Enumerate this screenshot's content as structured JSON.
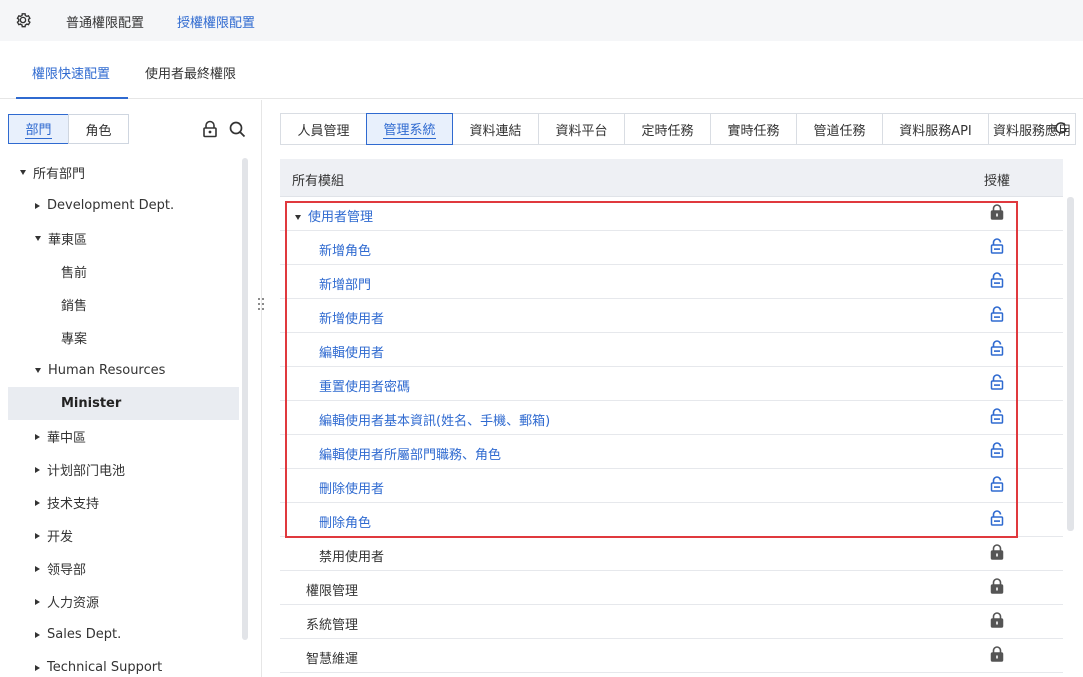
{
  "topbar": {
    "tabs": [
      "普通權限配置",
      "授權權限配置"
    ],
    "active_tab": 1
  },
  "subtabs": {
    "items": [
      "權限快速配置",
      "使用者最終權限"
    ],
    "active": 0
  },
  "left": {
    "segments": [
      "部門",
      "角色"
    ],
    "active_segment": 0,
    "tree": [
      {
        "label": "所有部門",
        "level": 0,
        "caret": "down"
      },
      {
        "label": "Development Dept.",
        "level": 1,
        "caret": "right"
      },
      {
        "label": "華東區",
        "level": 1,
        "caret": "down"
      },
      {
        "label": "售前",
        "level": 2,
        "caret": "none"
      },
      {
        "label": "銷售",
        "level": 2,
        "caret": "none"
      },
      {
        "label": "專案",
        "level": 2,
        "caret": "none"
      },
      {
        "label": "Human Resources",
        "level": 1,
        "caret": "down"
      },
      {
        "label": "Minister",
        "level": 2,
        "caret": "none",
        "selected": true
      },
      {
        "label": "華中區",
        "level": 1,
        "caret": "right"
      },
      {
        "label": "计划部门电池",
        "level": 1,
        "caret": "right"
      },
      {
        "label": "技术支持",
        "level": 1,
        "caret": "right"
      },
      {
        "label": "开发",
        "level": 1,
        "caret": "right"
      },
      {
        "label": "领导部",
        "level": 1,
        "caret": "right"
      },
      {
        "label": "人力资源",
        "level": 1,
        "caret": "right"
      },
      {
        "label": "Sales Dept.",
        "level": 1,
        "caret": "right"
      },
      {
        "label": "Technical Support",
        "level": 1,
        "caret": "right"
      }
    ]
  },
  "modules": {
    "tabs": [
      "人員管理",
      "管理系統",
      "資料連結",
      "資料平台",
      "定時任務",
      "實時任務",
      "管道任務",
      "資料服務API",
      "資料服務應用"
    ],
    "active": 1
  },
  "table": {
    "header_module": "所有模組",
    "header_auth": "授權",
    "rows": [
      {
        "label": "使用者管理",
        "indent": 1,
        "caret": "down",
        "color": "blue",
        "lock": "locked"
      },
      {
        "label": "新增角色",
        "indent": 2,
        "caret": "none",
        "color": "blue",
        "lock": "unlocked"
      },
      {
        "label": "新增部門",
        "indent": 2,
        "caret": "none",
        "color": "blue",
        "lock": "unlocked"
      },
      {
        "label": "新增使用者",
        "indent": 2,
        "caret": "none",
        "color": "blue",
        "lock": "unlocked"
      },
      {
        "label": "編輯使用者",
        "indent": 2,
        "caret": "none",
        "color": "blue",
        "lock": "unlocked"
      },
      {
        "label": "重置使用者密碼",
        "indent": 2,
        "caret": "none",
        "color": "blue",
        "lock": "unlocked"
      },
      {
        "label": "編輯使用者基本資訊(姓名、手機、郵箱)",
        "indent": 2,
        "caret": "none",
        "color": "blue",
        "lock": "unlocked"
      },
      {
        "label": "編輯使用者所屬部門職務、角色",
        "indent": 2,
        "caret": "none",
        "color": "blue",
        "lock": "unlocked"
      },
      {
        "label": "刪除使用者",
        "indent": 2,
        "caret": "none",
        "color": "blue",
        "lock": "unlocked"
      },
      {
        "label": "刪除角色",
        "indent": 2,
        "caret": "none",
        "color": "blue",
        "lock": "unlocked"
      },
      {
        "label": "禁用使用者",
        "indent": 2,
        "caret": "none",
        "color": "dark",
        "lock": "locked"
      },
      {
        "label": "權限管理",
        "indent": 1,
        "caret": "none",
        "color": "dark",
        "lock": "locked"
      },
      {
        "label": "系統管理",
        "indent": 1,
        "caret": "none",
        "color": "dark",
        "lock": "locked"
      },
      {
        "label": "智慧維運",
        "indent": 1,
        "caret": "none",
        "color": "dark",
        "lock": "locked"
      }
    ]
  },
  "colors": {
    "accent": "#2f6ad0",
    "highlight_border": "#e0393e",
    "locked_icon": "#555555",
    "unlocked_icon": "#2f6ad0"
  }
}
